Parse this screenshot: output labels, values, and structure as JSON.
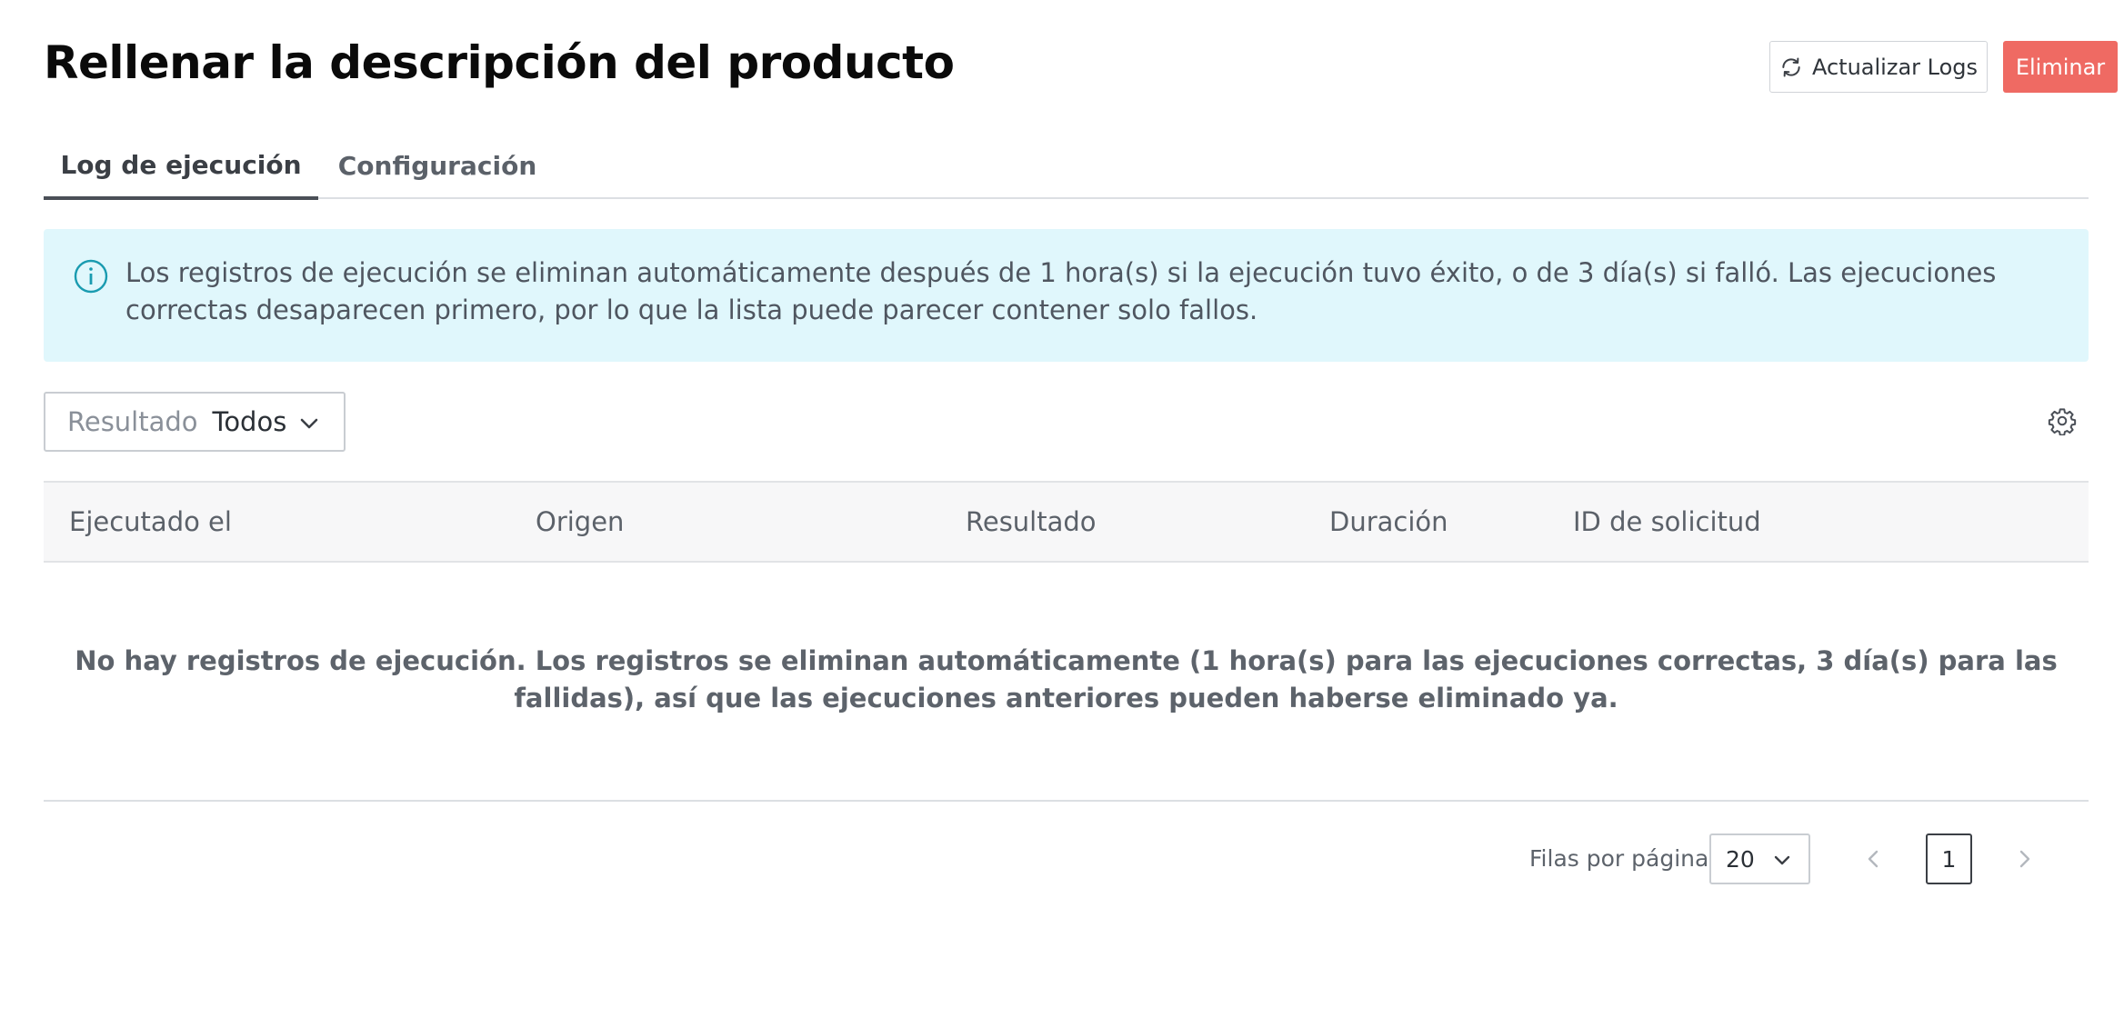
{
  "header": {
    "title": "Rellenar la descripción del producto",
    "refresh_label": "Actualizar Logs",
    "delete_label": "Eliminar"
  },
  "tabs": [
    {
      "label": "Log de ejecución",
      "active": true
    },
    {
      "label": "Configuración",
      "active": false
    }
  ],
  "info": {
    "text": "Los registros de ejecución se eliminan automáticamente después de 1 hora(s) si la ejecución tuvo éxito, o de 3 día(s) si falló. Las ejecuciones correctas desaparecen primero, por lo que la lista puede parecer contener solo fallos."
  },
  "filter": {
    "label": "Resultado",
    "value": "Todos"
  },
  "table": {
    "columns": [
      "Ejecutado el",
      "Origen",
      "Resultado",
      "Duración",
      "ID de solicitud"
    ],
    "rows": [],
    "empty_message": "No hay registros de ejecución. Los registros se eliminan automáticamente (1 hora(s) para las ejecuciones correctas, 3 día(s) para las fallidas), así que las ejecuciones anteriores pueden haberse eliminado ya."
  },
  "pagination": {
    "rows_per_page_label": "Filas por página",
    "rows_per_page": "20",
    "current_page": "1"
  },
  "colors": {
    "danger": "#ef6a63",
    "info_bg": "#e0f7fc",
    "info_icon": "#1a9bb0"
  },
  "icons": {
    "refresh": "refresh-icon",
    "info": "info-icon",
    "chevron": "chevron-down-icon",
    "settings": "gear-icon",
    "prev": "chevron-left-icon",
    "next": "chevron-right-icon"
  }
}
